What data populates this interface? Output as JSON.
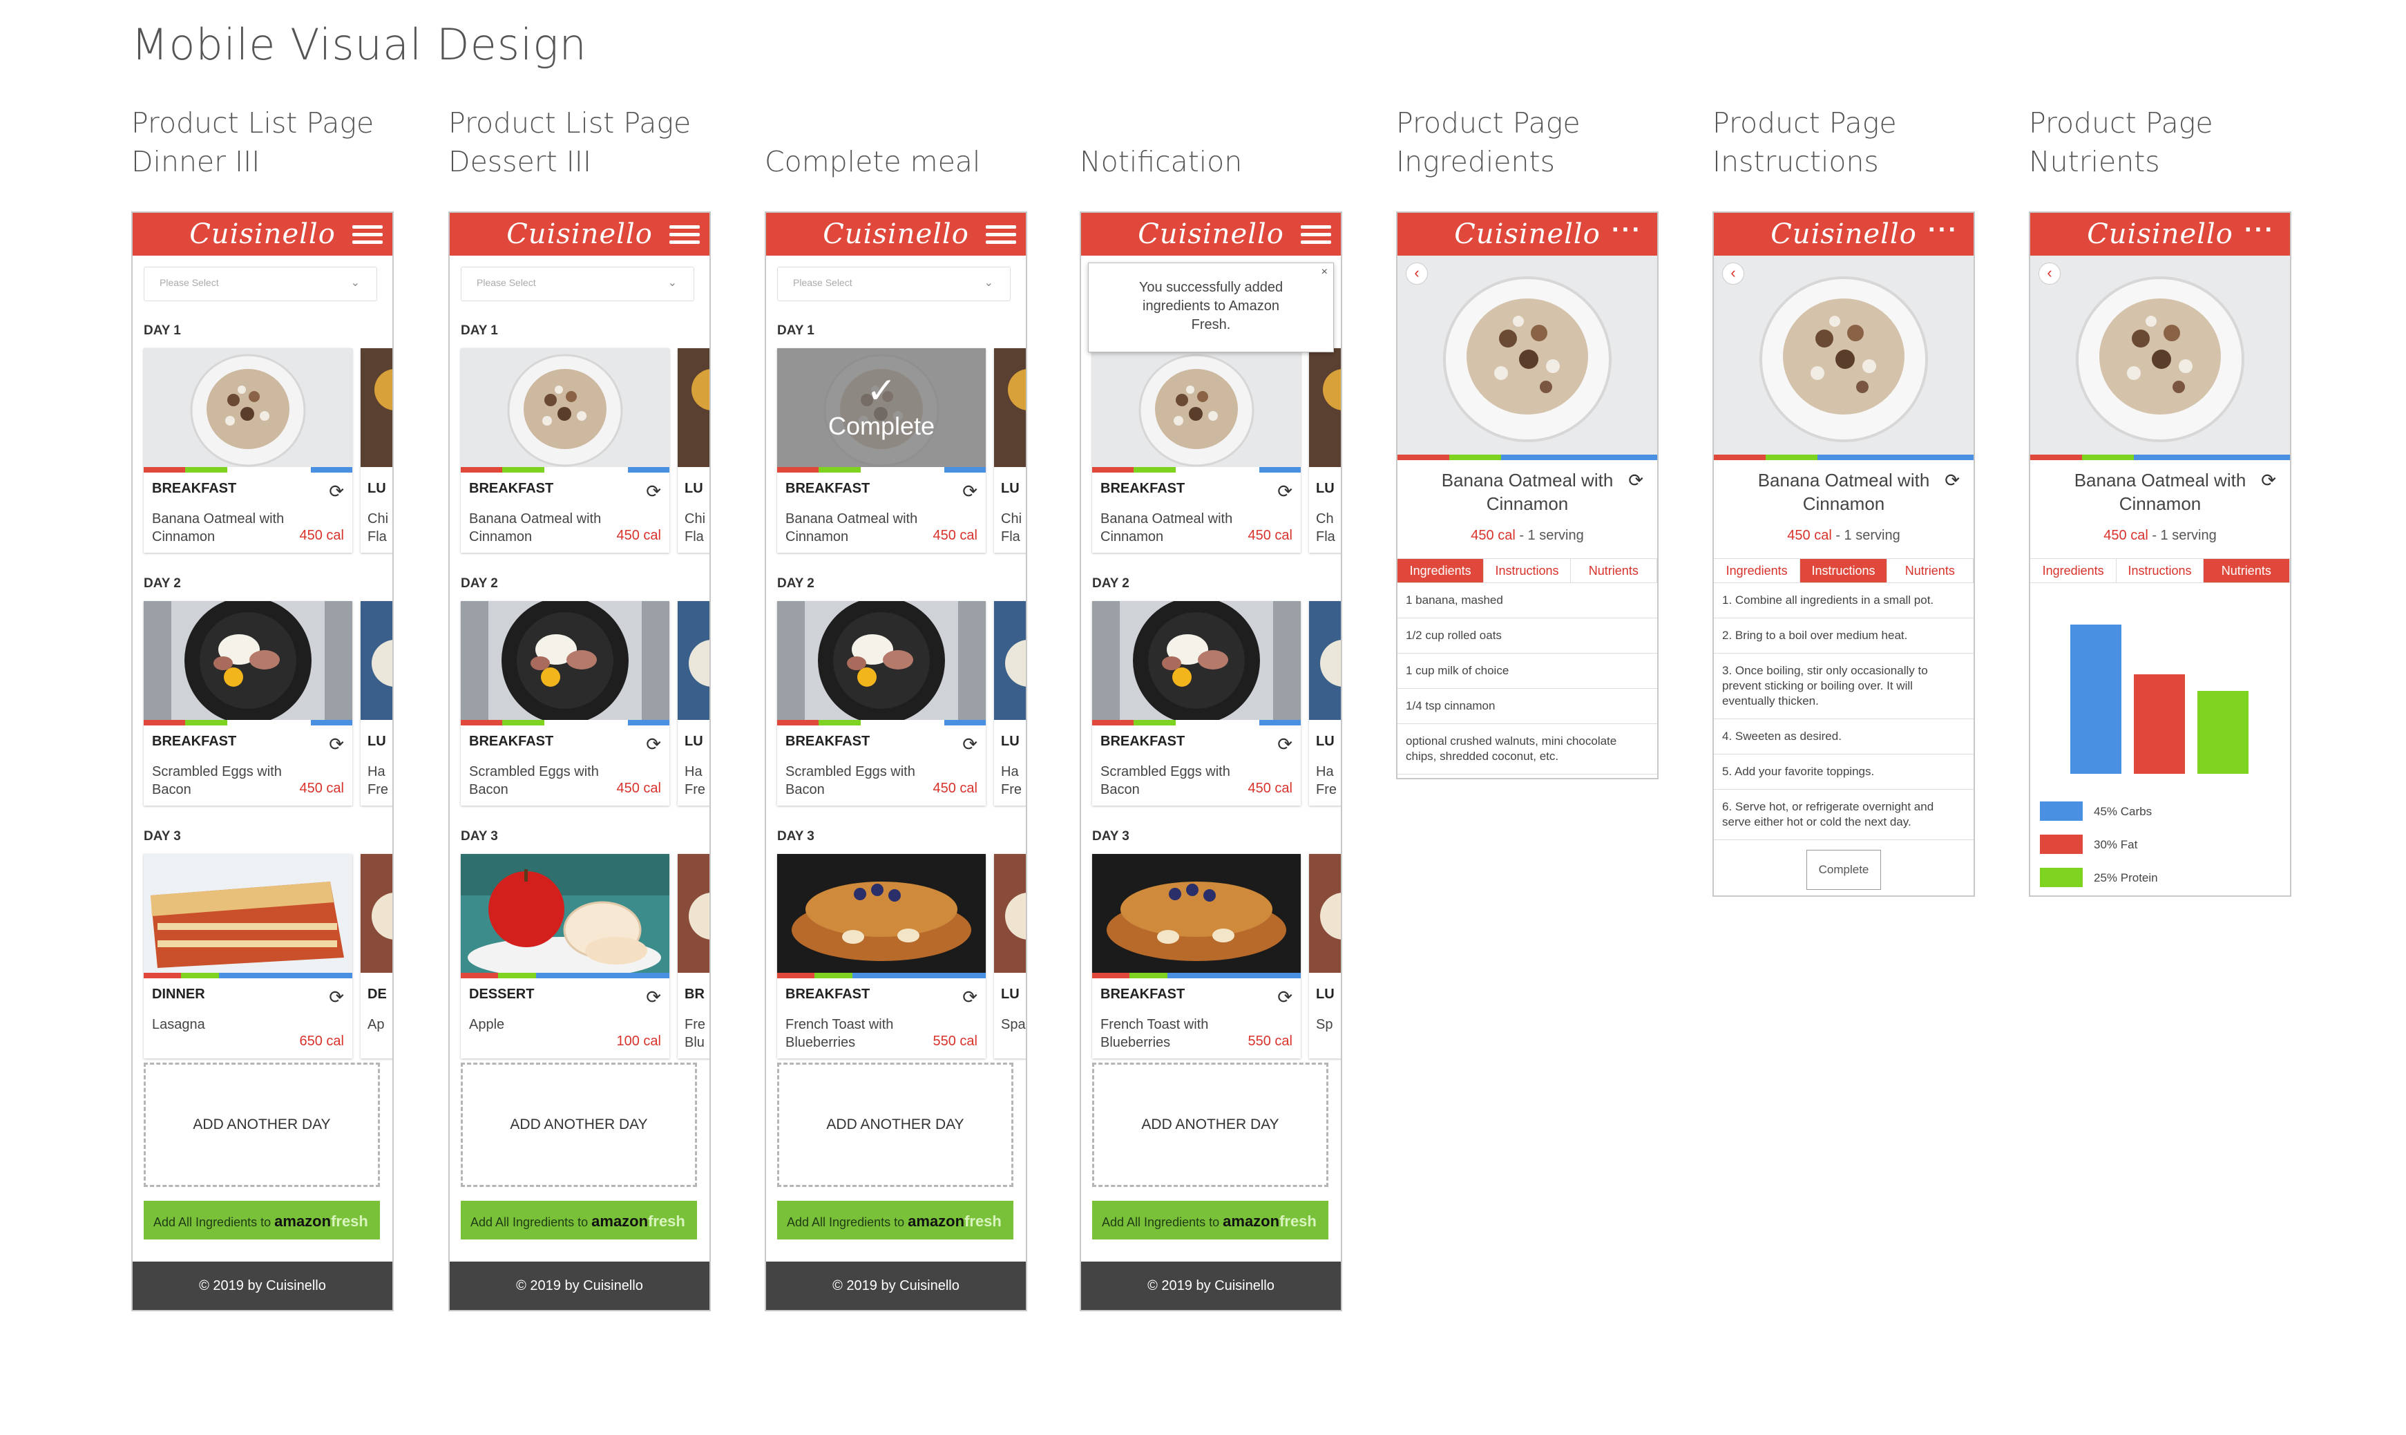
{
  "page_title": "Mobile Visual Design",
  "columns": [
    {
      "label_line1": "Product List Page",
      "label_line2": "Dinner III"
    },
    {
      "label_line1": "Product List Page",
      "label_line2": "Dessert III"
    },
    {
      "label_line1": "",
      "label_line2": "Complete meal"
    },
    {
      "label_line1": "",
      "label_line2": "Notification"
    },
    {
      "label_line1": "Product Page",
      "label_line2": "Ingredients"
    },
    {
      "label_line1": "Product Page",
      "label_line2": "Instructions"
    },
    {
      "label_line1": "Product Page",
      "label_line2": "Nutrients"
    }
  ],
  "brand": "Cuisinello",
  "select_placeholder": "Please Select",
  "days": [
    "DAY 1",
    "DAY 2",
    "DAY 3"
  ],
  "add_day": "ADD ANOTHER DAY",
  "amazon": {
    "text": "Add All Ingredients to",
    "brand_a": "amazon",
    "brand_b": "fresh"
  },
  "footer": "© 2019 by Cuisinello",
  "complete_overlay": "Complete",
  "notification": {
    "text": "You successfully added ingredients to Amazon Fresh.",
    "close": "×"
  },
  "lists": [
    {
      "cards": [
        {
          "type": "BREAKFAST",
          "name": "Banana Oatmeal with Cinnamon",
          "cal": "450 cal",
          "peek_type": "LU",
          "peek_name": "Chi\nFla"
        },
        {
          "type": "BREAKFAST",
          "name": "Scrambled Eggs with Bacon",
          "cal": "450 cal",
          "peek_type": "LU",
          "peek_name": "Ha\nFre"
        },
        {
          "type": "DINNER",
          "name": "Lasagna",
          "cal": "650 cal",
          "peek_type": "DE",
          "peek_name": "Ap"
        }
      ]
    },
    {
      "cards": [
        {
          "type": "BREAKFAST",
          "name": "Banana Oatmeal with Cinnamon",
          "cal": "450 cal",
          "peek_type": "LU",
          "peek_name": "Chi\nFla"
        },
        {
          "type": "BREAKFAST",
          "name": "Scrambled Eggs with Bacon",
          "cal": "450 cal",
          "peek_type": "LU",
          "peek_name": "Ha\nFre"
        },
        {
          "type": "DESSERT",
          "name": "Apple",
          "cal": "100 cal",
          "peek_type": "BR",
          "peek_name": "Fre\nBlu"
        }
      ]
    },
    {
      "cards": [
        {
          "type": "BREAKFAST",
          "name": "Banana Oatmeal with Cinnamon",
          "cal": "450 cal",
          "peek_type": "LU",
          "peek_name": "Chi\nFla"
        },
        {
          "type": "BREAKFAST",
          "name": "Scrambled Eggs with Bacon",
          "cal": "450 cal",
          "peek_type": "LU",
          "peek_name": "Ha\nFre"
        },
        {
          "type": "BREAKFAST",
          "name": "French Toast with Blueberries",
          "cal": "550 cal",
          "peek_type": "LU",
          "peek_name": "Spa"
        }
      ]
    },
    {
      "cards": [
        {
          "type": "BREAKFAST",
          "name": "Banana Oatmeal with Cinnamon",
          "cal": "450 cal",
          "peek_type": "LU",
          "peek_name": "Ch\nFla"
        },
        {
          "type": "BREAKFAST",
          "name": "Scrambled Eggs with Bacon",
          "cal": "450 cal",
          "peek_type": "LU",
          "peek_name": "Ha\nFre"
        },
        {
          "type": "BREAKFAST",
          "name": "French Toast with Blueberries",
          "cal": "550 cal",
          "peek_type": "LU",
          "peek_name": "Sp"
        }
      ]
    }
  ],
  "product": {
    "name": "Banana Oatmeal with Cinnamon",
    "cal": "450 cal",
    "serving": " - 1 serving",
    "tabs": [
      "Ingredients",
      "Instructions",
      "Nutrients"
    ],
    "ingredients": [
      "1 banana, mashed",
      "1/2 cup rolled oats",
      "1 cup milk of choice",
      "1/4 tsp cinnamon",
      "optional crushed walnuts, mini chocolate chips, shredded coconut, etc."
    ],
    "instructions": [
      "1.  Combine all ingredients in a small pot.",
      "2.  Bring to a boil over medium heat.",
      "3. Once boiling, stir only occasionally to prevent sticking or boiling over.  It will eventually thicken.",
      "4. Sweeten as desired.",
      "5. Add your favorite toppings.",
      "6. Serve hot, or refrigerate overnight and serve either hot or cold the next day."
    ],
    "complete_button": "Complete"
  },
  "chart_data": {
    "type": "bar",
    "categories": [
      "Carbs",
      "Fat",
      "Protein"
    ],
    "values": [
      45,
      30,
      25
    ],
    "colors": [
      "#4a90e2",
      "#e0483b",
      "#7ed321"
    ],
    "legend": [
      "45% Carbs",
      "30% Fat",
      "25% Protein"
    ],
    "ylim": [
      0,
      50
    ],
    "title": "",
    "xlabel": "",
    "ylabel": ""
  },
  "colors": {
    "brand_red": "#e0483b",
    "calorie_red": "#d9322b",
    "amazon_green": "#7ac13a",
    "footer_gray": "#444444"
  }
}
